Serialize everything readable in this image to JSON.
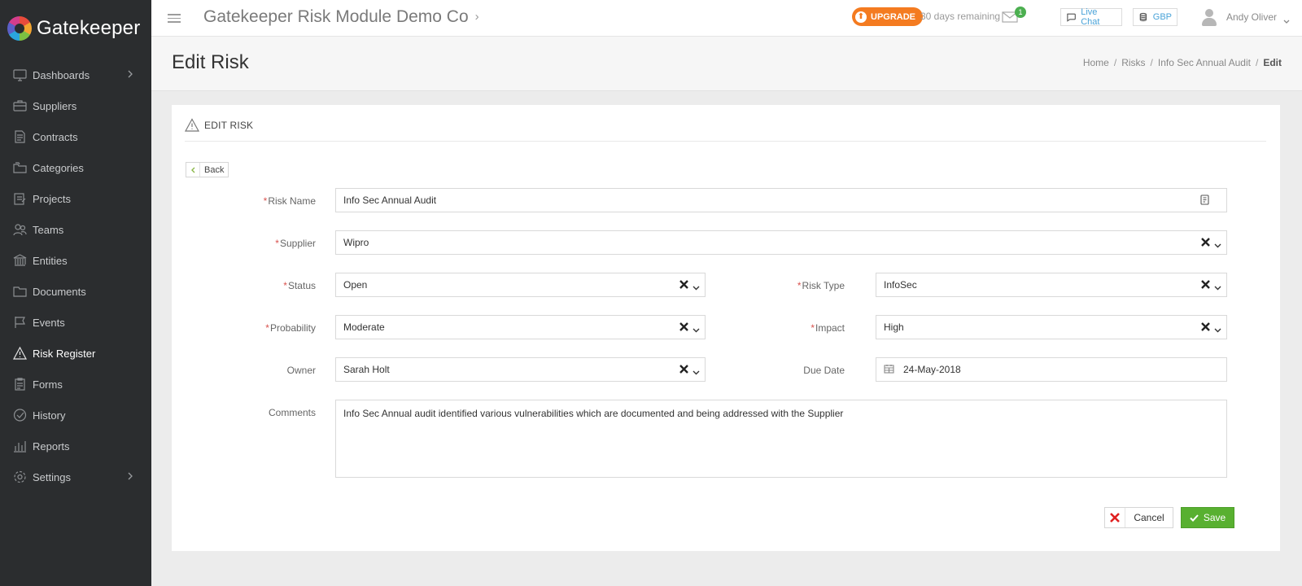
{
  "app": {
    "name": "Gatekeeper"
  },
  "sidebar": {
    "items": [
      {
        "label": "Dashboards",
        "icon": "monitor-icon"
      },
      {
        "label": "Suppliers",
        "icon": "briefcase-icon"
      },
      {
        "label": "Contracts",
        "icon": "document-icon"
      },
      {
        "label": "Categories",
        "icon": "folders-icon"
      },
      {
        "label": "Projects",
        "icon": "clipboard-icon"
      },
      {
        "label": "Teams",
        "icon": "people-icon"
      },
      {
        "label": "Entities",
        "icon": "bank-icon"
      },
      {
        "label": "Documents",
        "icon": "folder-icon"
      },
      {
        "label": "Events",
        "icon": "flag-icon"
      },
      {
        "label": "Risk Register",
        "icon": "warning-icon",
        "active": true
      },
      {
        "label": "Forms",
        "icon": "form-icon"
      },
      {
        "label": "History",
        "icon": "clock-icon"
      },
      {
        "label": "Reports",
        "icon": "bar-chart-icon"
      },
      {
        "label": "Settings",
        "icon": "gear-icon"
      }
    ]
  },
  "topbar": {
    "company": "Gatekeeper Risk Module Demo Co",
    "upgrade_label": "UPGRADE",
    "days_remaining": "30 days remaining",
    "mail_count": "1",
    "live_chat": "Live Chat",
    "currency": "GBP",
    "user_name": "Andy Oliver"
  },
  "page": {
    "title": "Edit Risk",
    "breadcrumb": [
      "Home",
      "Risks",
      "Info Sec Annual Audit",
      "Edit"
    ]
  },
  "form": {
    "section_title": "EDIT RISK",
    "back_label": "Back",
    "risk_name": {
      "label": "Risk Name",
      "value": "Info Sec Annual Audit"
    },
    "supplier": {
      "label": "Supplier",
      "value": "Wipro"
    },
    "status": {
      "label": "Status",
      "value": "Open"
    },
    "risk_type": {
      "label": "Risk Type",
      "value": "InfoSec"
    },
    "probability": {
      "label": "Probability",
      "value": "Moderate"
    },
    "impact": {
      "label": "Impact",
      "value": "High"
    },
    "owner": {
      "label": "Owner",
      "value": "Sarah Holt"
    },
    "due_date": {
      "label": "Due Date",
      "value": "24-May-2018"
    },
    "comments": {
      "label": "Comments",
      "value": "Info Sec Annual audit identified various vulnerabilities which are documented and being addressed with the Supplier"
    },
    "required_mark": "*",
    "cancel_label": "Cancel",
    "save_label": "Save"
  },
  "colors": {
    "sidebar_bg": "#2b2d2f",
    "upgrade": "#f47b20",
    "save": "#58b030",
    "required": "#d9534f",
    "link": "#4aa3d8"
  }
}
